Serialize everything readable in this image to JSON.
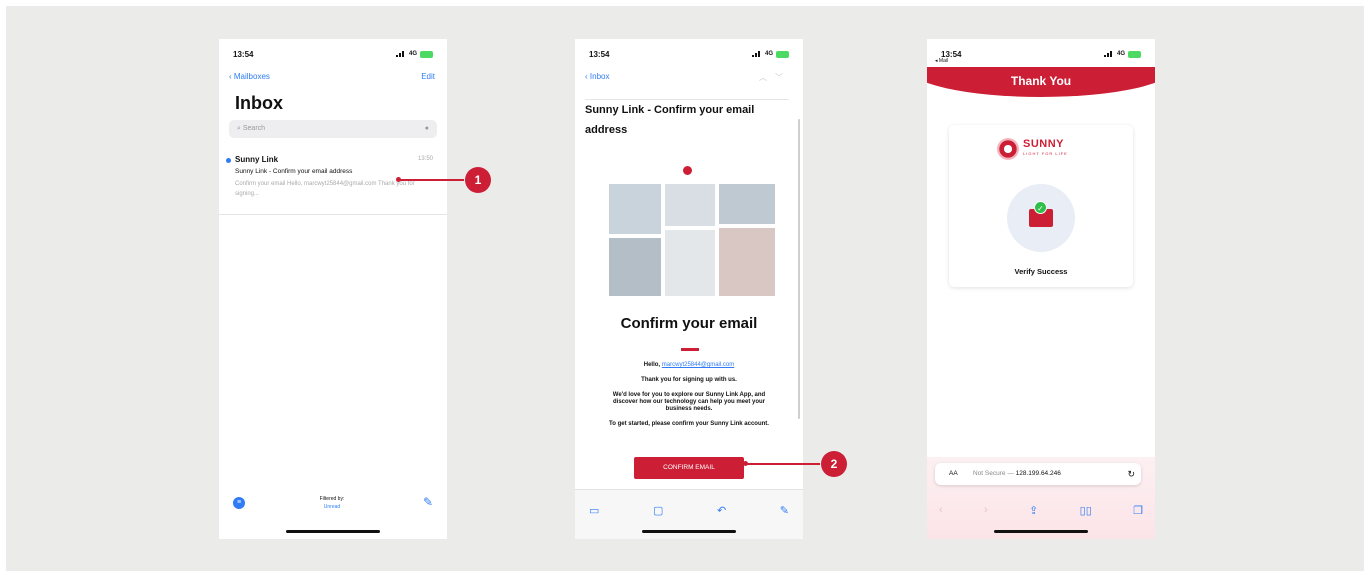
{
  "phone1": {
    "status_time": "13:54",
    "status_net": "4G",
    "nav_back": "Mailboxes",
    "nav_edit": "Edit",
    "title": "Inbox",
    "search_placeholder": "Search",
    "mail": {
      "from": "Sunny Link",
      "time": "13:50",
      "subject": "Sunny Link - Confirm your email address",
      "preview": "Confirm your email Hello, marcwyt25844@gmail.com Thank you for signing..."
    },
    "filter_label": "Filtered by:",
    "filter_value": "Unread"
  },
  "phone2": {
    "status_time": "13:54",
    "status_net": "4G",
    "nav_back": "Inbox",
    "subject": "Sunny Link - Confirm your email address",
    "heading": "Confirm your email",
    "greeting": "Hello,",
    "email": "marcwyt25844@gmail.com",
    "thanks": "Thank you for signing up with us.",
    "explore": "We'd love for you to explore our Sunny Link App, and discover how our technology can help you meet your business needs.",
    "get_started": "To get started, please confirm your Sunny Link account.",
    "cta": "CONFIRM EMAIL"
  },
  "phone3": {
    "status_time": "13:54",
    "status_net": "4G",
    "back": "◂ Mail",
    "banner_title": "Thank You",
    "logo_name": "SUNNY",
    "logo_tagline": "LIGHT FOR LIFE",
    "verify_text": "Verify Success",
    "url_aa": "AA",
    "url_prefix": "Not Secure —",
    "url_host": "128.199.64.246"
  },
  "markers": [
    "1",
    "2"
  ],
  "colors": {
    "accent": "#cc1f36",
    "ios_blue": "#2f7cf6",
    "stage": "#ebebea"
  }
}
